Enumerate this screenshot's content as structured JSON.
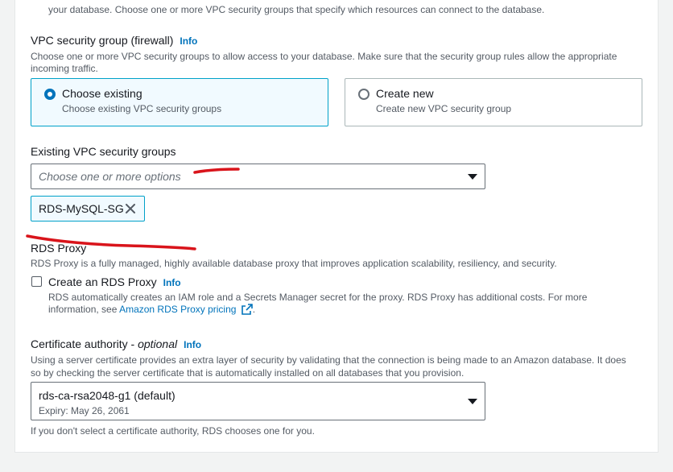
{
  "top_text": "your database. Choose one or more VPC security groups that specify which resources can connect to the database.",
  "vpc_sg": {
    "label": "VPC security group (firewall)",
    "info": "Info",
    "description_line1": "Choose one or more VPC security groups to allow access to your database. Make sure that the security group rules allow the appropriate",
    "description_line2": "incoming traffic.",
    "options": [
      {
        "title": "Choose existing",
        "subtitle": "Choose existing VPC security groups",
        "selected": true
      },
      {
        "title": "Create new",
        "subtitle": "Create new VPC security group",
        "selected": false
      }
    ]
  },
  "existing_sg": {
    "label": "Existing VPC security groups",
    "placeholder": "Choose one or more options",
    "tokens": [
      "RDS-MySQL-SG"
    ]
  },
  "rds_proxy": {
    "heading": "RDS Proxy",
    "description": "RDS Proxy is a fully managed, highly available database proxy that improves application scalability, resiliency, and security.",
    "checkbox_label": "Create an RDS Proxy",
    "checked": false,
    "info": "Info",
    "help_line1": "RDS automatically creates an IAM role and a Secrets Manager secret for the proxy. RDS Proxy has additional costs. For more",
    "help_line2_prefix": "information, see ",
    "help_link": "Amazon RDS Proxy pricing",
    "help_line2_suffix": "."
  },
  "cert": {
    "label": "Certificate authority - ",
    "label_optional": "optional",
    "info": "Info",
    "description_line1": "Using a server certificate provides an extra layer of security by validating that the connection is being made to an Amazon database. It does",
    "description_line2": "so by checking the server certificate that is automatically installed on all databases that you provision.",
    "selected_value": "rds-ca-rsa2048-g1 (default)",
    "selected_sub": "Expiry: May 26, 2061",
    "footer": "If you don't select a certificate authority, RDS chooses one for you."
  },
  "colors": {
    "accent": "#0073bb",
    "selected_border": "#00a1c9",
    "selected_bg": "#f1faff",
    "annotation_red": "#d9141b"
  }
}
